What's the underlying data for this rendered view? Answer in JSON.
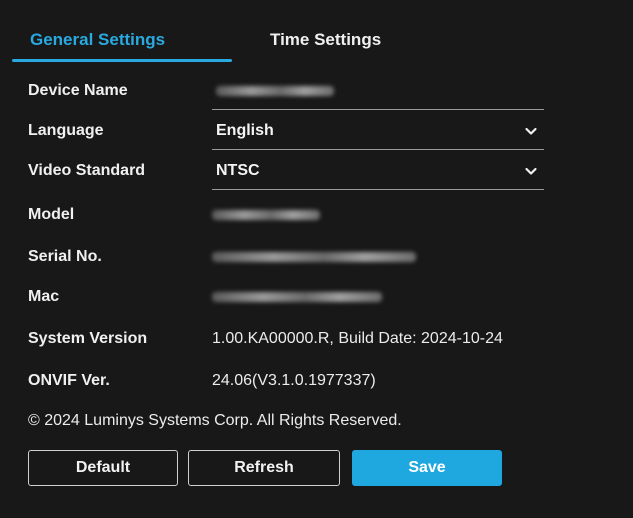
{
  "tabs": [
    {
      "label": "General Settings",
      "active": true
    },
    {
      "label": "Time Settings",
      "active": false
    }
  ],
  "fields": {
    "device_name": {
      "label": "Device Name",
      "value": ""
    },
    "language": {
      "label": "Language",
      "value": "English"
    },
    "video_standard": {
      "label": "Video Standard",
      "value": "NTSC"
    },
    "model": {
      "label": "Model",
      "value": ""
    },
    "serial_no": {
      "label": "Serial No.",
      "value": ""
    },
    "mac": {
      "label": "Mac",
      "value": ""
    },
    "system_version": {
      "label": "System Version",
      "value": "1.00.KA00000.R, Build Date: 2024-10-24"
    },
    "onvif_ver": {
      "label": "ONVIF Ver.",
      "value": "24.06(V3.1.0.1977337)"
    }
  },
  "copyright": "© 2024 Luminys Systems Corp. All Rights Reserved.",
  "buttons": {
    "default": "Default",
    "refresh": "Refresh",
    "save": "Save"
  },
  "colors": {
    "accent": "#29a9df",
    "save_button": "#1fa8e0",
    "background": "#181818"
  },
  "icons": {
    "dropdown": "chevron-down-icon"
  }
}
